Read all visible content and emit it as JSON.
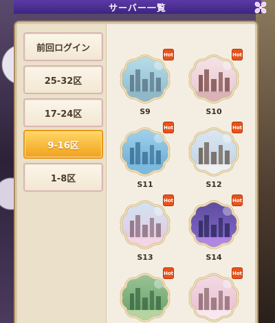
{
  "header": {
    "title": "サーバー一覧"
  },
  "sidebar": {
    "tabs": [
      {
        "label": "前回ログイン",
        "active": false
      },
      {
        "label": "25-32区",
        "active": false
      },
      {
        "label": "17-24区",
        "active": false
      },
      {
        "label": "9-16区",
        "active": true
      },
      {
        "label": "1-8区",
        "active": false
      }
    ]
  },
  "servers": [
    {
      "name": "S9",
      "badge": "Hot",
      "scene": "city-sea"
    },
    {
      "name": "S10",
      "badge": "Hot",
      "scene": "pagoda-sakura"
    },
    {
      "name": "S11",
      "badge": "Hot",
      "scene": "skyline-water"
    },
    {
      "name": "S12",
      "badge": "Hot",
      "scene": "tower-blossom"
    },
    {
      "name": "S13",
      "badge": "Hot",
      "scene": "temple-sakura"
    },
    {
      "name": "S14",
      "badge": "Hot",
      "scene": "neon-city"
    },
    {
      "name": "",
      "badge": "Hot",
      "scene": "forest"
    },
    {
      "name": "",
      "badge": "Hot",
      "scene": "sakura-path"
    }
  ],
  "colors": {
    "header": "#4a2e95",
    "active_tab": "#f2a11b",
    "hot_badge": "#e8531c"
  }
}
